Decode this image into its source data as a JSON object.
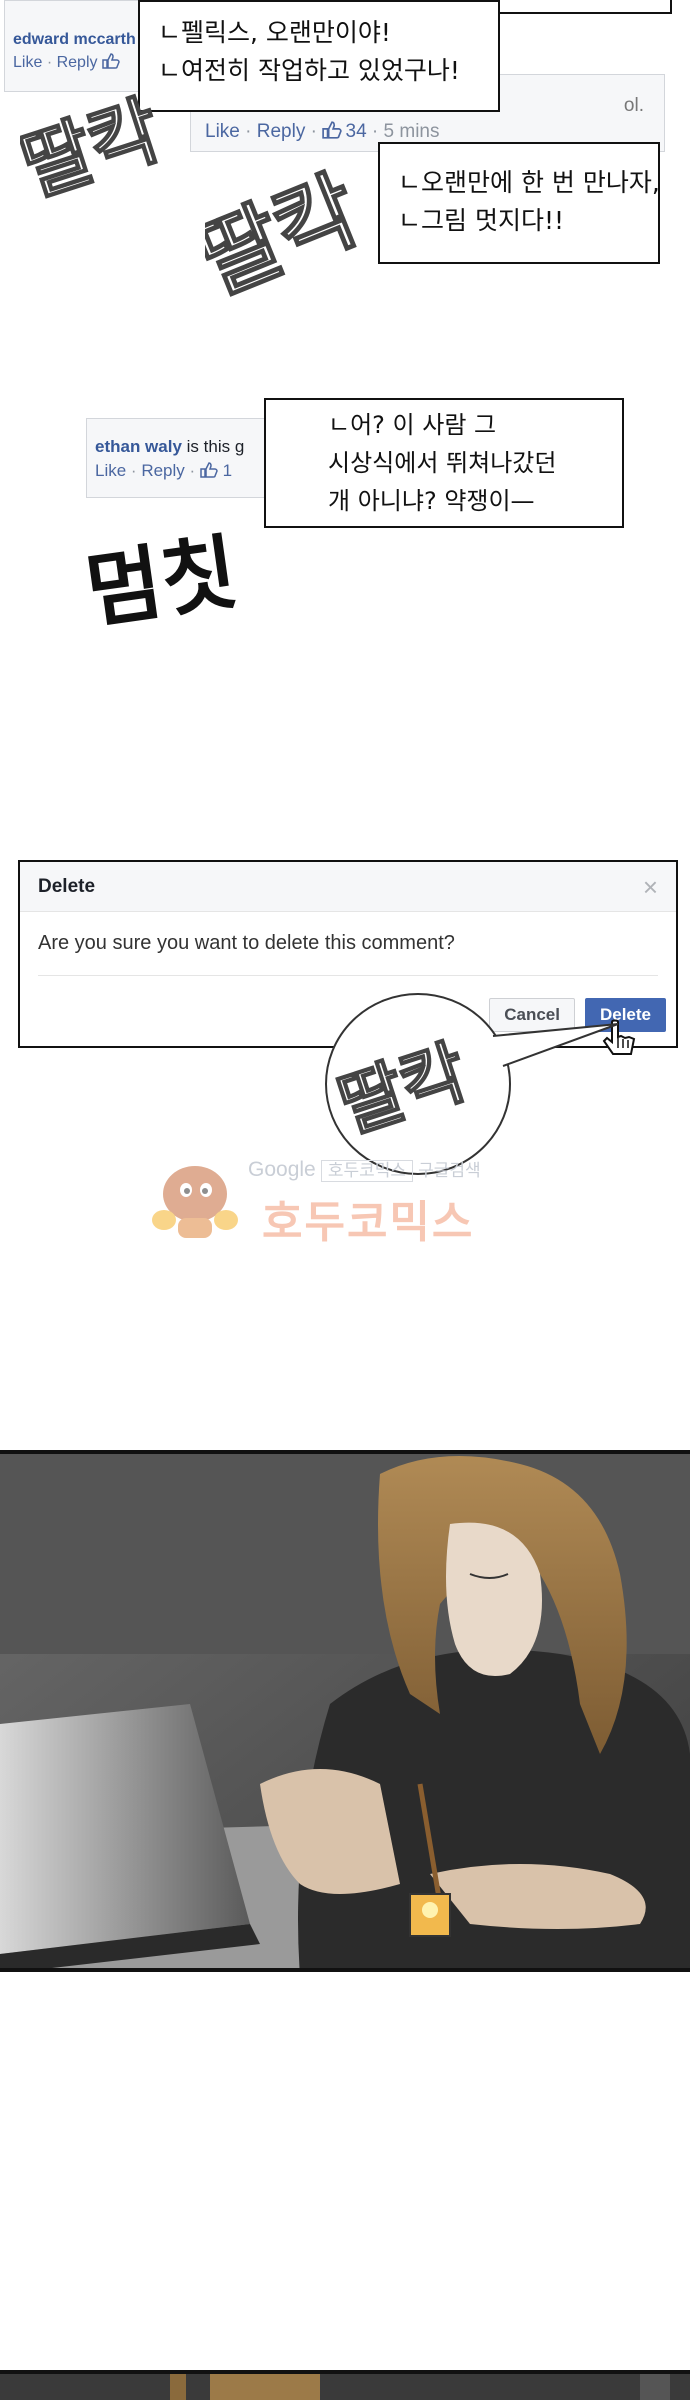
{
  "top_comments": {
    "comment_a": {
      "name": "edward mccarth",
      "meta_like": "Like",
      "meta_reply": "Reply",
      "meta_sep": "·"
    },
    "comment_b": {
      "meta_like": "Like",
      "meta_reply": "Reply",
      "meta_sep": "·",
      "like_count": "34",
      "time": "5 mins",
      "tail": "ol."
    }
  },
  "speech": {
    "bubble1": [
      "ㄴ펠릭스, 오랜만이야!",
      "ㄴ여전히 작업하고 있었구나!"
    ],
    "bubble2": [
      "ㄴ오랜만에 한 번 만나자,",
      "ㄴ그림 멋지다!!"
    ],
    "bubble3": [
      "ㄴ어? 이 사람 그",
      "시상식에서 뛰쳐나갔던",
      "개 아니냐? 약쟁이—"
    ]
  },
  "comment_ethan": {
    "name": "ethan waly",
    "text": "is this g",
    "meta_like": "Like",
    "meta_reply": "Reply",
    "meta_sep": "·",
    "like_count": "1"
  },
  "sfx": {
    "click1": "딸칵",
    "click2": "딸칵",
    "freeze": "멈칫",
    "click3": "딸칵"
  },
  "dialog": {
    "title": "Delete",
    "close": "×",
    "message": "Are you sure you want to delete this comment?",
    "cancel_label": "Cancel",
    "delete_label": "Delete"
  },
  "watermark": {
    "google": "Google",
    "site_box": "호두코믹스",
    "search": "구글검색",
    "big": "호두코믹스"
  },
  "colors": {
    "fb_blue": "#4267b2",
    "fb_link": "#365899",
    "fb_meta": "#8d949e"
  }
}
